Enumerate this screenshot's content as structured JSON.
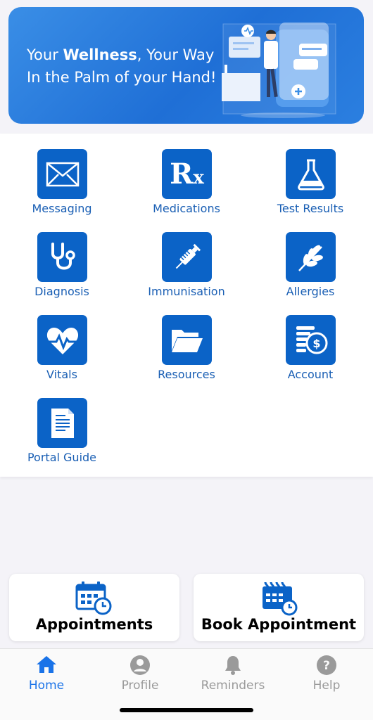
{
  "banner": {
    "line1_prefix": "Your ",
    "line1_bold": "Wellness",
    "line1_suffix": ", Your Way",
    "line2": "In the Palm of your Hand!"
  },
  "menu": [
    {
      "label": "Messaging",
      "icon": "envelope-icon"
    },
    {
      "label": "Medications",
      "icon": "rx-icon"
    },
    {
      "label": "Test Results",
      "icon": "flask-icon"
    },
    {
      "label": "Diagnosis",
      "icon": "stethoscope-icon"
    },
    {
      "label": "Immunisation",
      "icon": "syringe-icon"
    },
    {
      "label": "Allergies",
      "icon": "wheat-icon"
    },
    {
      "label": "Vitals",
      "icon": "heart-pulse-icon"
    },
    {
      "label": "Resources",
      "icon": "folder-icon"
    },
    {
      "label": "Account",
      "icon": "coins-dollar-icon"
    },
    {
      "label": "Portal Guide",
      "icon": "document-icon"
    }
  ],
  "actions": {
    "appointments": "Appointments",
    "book": "Book Appointment"
  },
  "tabs": [
    {
      "label": "Home",
      "icon": "home-icon",
      "active": true
    },
    {
      "label": "Profile",
      "icon": "user-icon",
      "active": false
    },
    {
      "label": "Reminders",
      "icon": "bell-icon",
      "active": false
    },
    {
      "label": "Help",
      "icon": "question-icon",
      "active": false
    }
  ],
  "colors": {
    "accent": "#0b63c7",
    "label": "#1a5fb4",
    "tab_active": "#1a73e8",
    "tab_inactive": "#9a9a9a"
  }
}
